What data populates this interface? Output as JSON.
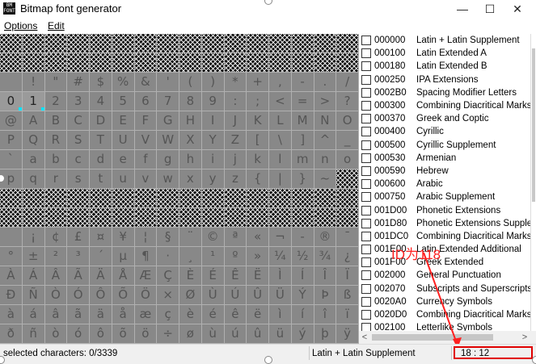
{
  "window": {
    "title": "Bitmap font generator",
    "app_icon_text": "BM\nFONT",
    "controls": {
      "minimize": "—",
      "maximize": "☐",
      "close": "✕"
    }
  },
  "menu": {
    "items": [
      "Options",
      "Edit"
    ]
  },
  "character_grid": {
    "rows": [
      {
        "hatched": true,
        "chars": []
      },
      {
        "hatched": true,
        "chars": []
      },
      {
        "hatched": false,
        "chars": [
          "",
          "!",
          "\"",
          "#",
          "$",
          "%",
          "&",
          "'",
          "(",
          ")",
          "*",
          "+",
          ",",
          "-",
          ".",
          "/"
        ]
      },
      {
        "hatched": false,
        "chars": [
          "0",
          "1",
          "2",
          "3",
          "4",
          "5",
          "6",
          "7",
          "8",
          "9",
          ":",
          ";",
          "<",
          "=",
          ">",
          "?"
        ]
      },
      {
        "hatched": false,
        "chars": [
          "@",
          "A",
          "B",
          "C",
          "D",
          "E",
          "F",
          "G",
          "H",
          "I",
          "J",
          "K",
          "L",
          "M",
          "N",
          "O"
        ]
      },
      {
        "hatched": false,
        "chars": [
          "P",
          "Q",
          "R",
          "S",
          "T",
          "U",
          "V",
          "W",
          "X",
          "Y",
          "Z",
          "[",
          "\\",
          "]",
          "^",
          "_"
        ]
      },
      {
        "hatched": false,
        "chars": [
          "`",
          "a",
          "b",
          "c",
          "d",
          "e",
          "f",
          "g",
          "h",
          "i",
          "j",
          "k",
          "l",
          "m",
          "n",
          "o"
        ]
      },
      {
        "hatched": false,
        "chars": [
          "p",
          "q",
          "r",
          "s",
          "t",
          "u",
          "v",
          "w",
          "x",
          "y",
          "z",
          "{",
          "|",
          "}",
          "~",
          ""
        ],
        "hatched_cells": [
          15
        ]
      },
      {
        "hatched": true,
        "chars": []
      },
      {
        "hatched": true,
        "chars": []
      },
      {
        "hatched": false,
        "chars": [
          "",
          "¡",
          "¢",
          "£",
          "¤",
          "¥",
          "¦",
          "§",
          "¨",
          "©",
          "ª",
          "«",
          "¬",
          "-",
          "®",
          "¯"
        ]
      },
      {
        "hatched": false,
        "chars": [
          "°",
          "±",
          "²",
          "³",
          "´",
          "µ",
          "¶",
          "·",
          "¸",
          "¹",
          "º",
          "»",
          "¼",
          "½",
          "¾",
          "¿"
        ]
      },
      {
        "hatched": false,
        "chars": [
          "À",
          "Á",
          "Â",
          "Ã",
          "Ä",
          "Å",
          "Æ",
          "Ç",
          "È",
          "É",
          "Ê",
          "Ë",
          "Ì",
          "Í",
          "Î",
          "Ï"
        ]
      },
      {
        "hatched": false,
        "chars": [
          "Ð",
          "Ñ",
          "Ò",
          "Ó",
          "Ô",
          "Õ",
          "Ö",
          "×",
          "Ø",
          "Ù",
          "Ú",
          "Û",
          "Ü",
          "Ý",
          "Þ",
          "ß"
        ]
      },
      {
        "hatched": false,
        "chars": [
          "à",
          "á",
          "â",
          "ã",
          "ä",
          "å",
          "æ",
          "ç",
          "è",
          "é",
          "ê",
          "ë",
          "ì",
          "í",
          "î",
          "ï"
        ]
      },
      {
        "hatched": false,
        "chars": [
          "ð",
          "ñ",
          "ò",
          "ó",
          "ô",
          "õ",
          "ö",
          "÷",
          "ø",
          "ù",
          "ú",
          "û",
          "ü",
          "ý",
          "þ",
          "ÿ"
        ]
      }
    ],
    "selected_cells": [
      [
        3,
        0
      ],
      [
        3,
        1
      ]
    ],
    "marker_color": "#00e5ff"
  },
  "ranges": [
    {
      "id": "000000",
      "name": "Latin + Latin Supplement"
    },
    {
      "id": "000100",
      "name": "Latin Extended A"
    },
    {
      "id": "000180",
      "name": "Latin Extended B"
    },
    {
      "id": "000250",
      "name": "IPA Extensions"
    },
    {
      "id": "0002B0",
      "name": "Spacing Modifier Letters"
    },
    {
      "id": "000300",
      "name": "Combining Diacritical Marks"
    },
    {
      "id": "000370",
      "name": "Greek and Coptic"
    },
    {
      "id": "000400",
      "name": "Cyrillic"
    },
    {
      "id": "000500",
      "name": "Cyrillic Supplement"
    },
    {
      "id": "000530",
      "name": "Armenian"
    },
    {
      "id": "000590",
      "name": "Hebrew"
    },
    {
      "id": "000600",
      "name": "Arabic"
    },
    {
      "id": "000750",
      "name": "Arabic Supplement"
    },
    {
      "id": "001D00",
      "name": "Phonetic Extensions"
    },
    {
      "id": "001D80",
      "name": "Phonetic Extensions Supple..."
    },
    {
      "id": "001DC0",
      "name": "Combining Diacritical Marks"
    },
    {
      "id": "001E00",
      "name": "Latin Extended Additional"
    },
    {
      "id": "001F00",
      "name": "Greek Extended"
    },
    {
      "id": "002000",
      "name": "General Punctuation"
    },
    {
      "id": "002070",
      "name": "Subscripts and Superscripts"
    },
    {
      "id": "0020A0",
      "name": "Currency Symbols"
    },
    {
      "id": "0020D0",
      "name": "Combining Diacritical Marks"
    },
    {
      "id": "002100",
      "name": "Letterlike Symbols"
    }
  ],
  "annotation": {
    "text": "ID为118",
    "color": "#ff2020"
  },
  "status": {
    "selected": "selected characters: 0/3339",
    "range": "Latin + Latin Supplement",
    "coords": "18 : 12"
  },
  "colors": {
    "highlight_box": "#e00000",
    "hatch": "#111111",
    "cell_bg": "#888888"
  }
}
